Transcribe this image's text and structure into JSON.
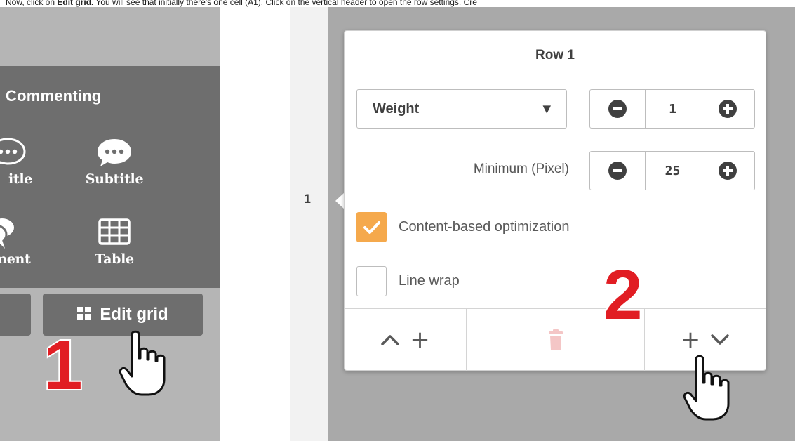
{
  "caption": {
    "prefix": "Now, click on ",
    "bold": "Edit grid.",
    "suffix": " You will see that initially there's one cell (A1). Click on the vertical header to open the row settings. Cre"
  },
  "ribbon": {
    "section_title": "Commenting",
    "tools": [
      {
        "label": "Title",
        "icon": "speech-bubble-icon"
      },
      {
        "label": "Subtitle",
        "icon": "speech-bubble-icon"
      },
      {
        "label": "Comment",
        "icon": "double-speech-bubble-icon"
      },
      {
        "label": "Table",
        "icon": "table-icon"
      }
    ],
    "tool_labels_visible": [
      "itle",
      "Subtitle",
      "nment",
      "Table"
    ]
  },
  "edit_grid_button": {
    "label": "Edit grid",
    "icon": "grid-icon"
  },
  "steps": {
    "one": "1",
    "two": "2"
  },
  "row_header": {
    "number": "1"
  },
  "popup": {
    "title": "Row 1",
    "size_mode": {
      "selected": "Weight"
    },
    "weight_value": "1",
    "minimum_label": "Minimum (Pixel)",
    "minimum_value": "25",
    "options": [
      {
        "label": "Content-based optimization",
        "checked": true
      },
      {
        "label": "Line wrap",
        "checked": false
      }
    ],
    "footer": {
      "insert_above": "+",
      "insert_below": "+"
    }
  },
  "colors": {
    "accent_orange": "#f5a94c",
    "step_red": "#e11d23",
    "ribbon_bg": "#6e6e6e",
    "grid_bg": "#a9a9a9",
    "delete_disabled": "#f4c6c6"
  }
}
